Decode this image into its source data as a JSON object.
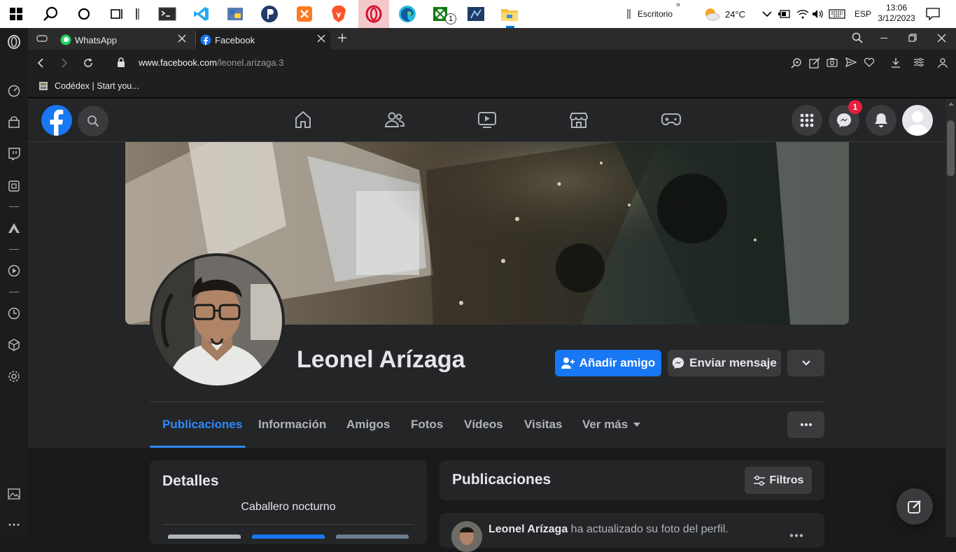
{
  "taskbar": {
    "desktop_label": "Escritorio",
    "temperature": "24°C",
    "language": "ESP",
    "time": "13:06",
    "date": "3/12/2023",
    "xbox_badge": "1"
  },
  "browser": {
    "tabs": [
      {
        "label": "WhatsApp"
      },
      {
        "label": "Facebook"
      }
    ],
    "url_domain": "www.facebook.com",
    "url_path": "/leonel.arizaga.3",
    "bookmark": "Codédex | Start you..."
  },
  "facebook": {
    "messenger_badge": "1",
    "profile_name": "Leonel Arízaga",
    "add_friend_label": "Añadir amigo",
    "send_message_label": "Enviar mensaje",
    "tabs": [
      "Publicaciones",
      "Información",
      "Amigos",
      "Fotos",
      "Vídeos",
      "Visitas",
      "Ver más"
    ],
    "details_title": "Detalles",
    "details_bio": "Caballero nocturno",
    "posts_title": "Publicaciones",
    "filters_label": "Filtros",
    "post_author": "Leonel Arízaga",
    "post_text": "ha actualizado su foto del perfil."
  },
  "colors": {
    "fb_blue": "#1877f2",
    "active_tab": "#2d88ff",
    "badge_red": "#e41e3f"
  }
}
